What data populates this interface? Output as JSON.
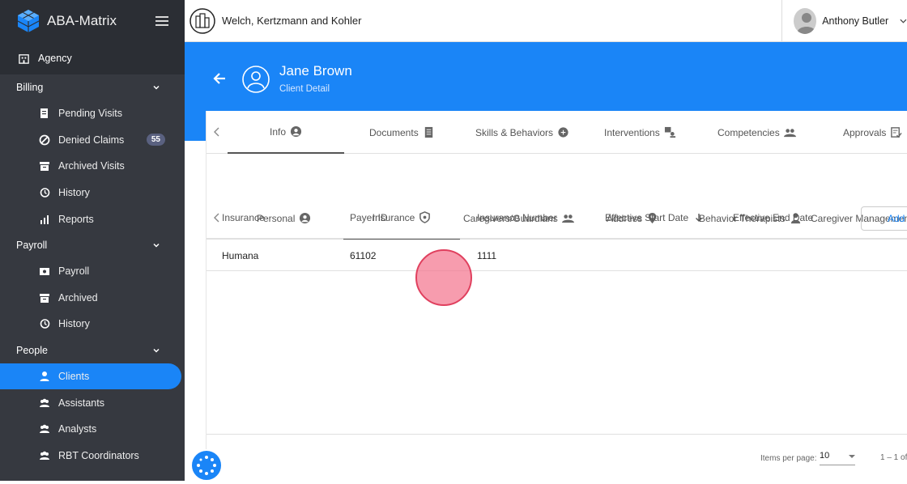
{
  "app": {
    "title": "ABA-Matrix"
  },
  "sidebar": {
    "agency": "Agency",
    "sections": [
      {
        "label": "Billing",
        "items": [
          {
            "label": "Pending Visits"
          },
          {
            "label": "Denied Claims",
            "badge": "55"
          },
          {
            "label": "Archived Visits"
          },
          {
            "label": "History"
          },
          {
            "label": "Reports"
          }
        ]
      },
      {
        "label": "Payroll",
        "items": [
          {
            "label": "Payroll"
          },
          {
            "label": "Archived"
          },
          {
            "label": "History"
          }
        ]
      },
      {
        "label": "People",
        "items": [
          {
            "label": "Clients",
            "active": true
          },
          {
            "label": "Assistants"
          },
          {
            "label": "Analysts"
          },
          {
            "label": "RBT Coordinators"
          }
        ]
      }
    ]
  },
  "topbar": {
    "company": "Welch, Kertzmann and Kohler",
    "user": "Anthony Butler"
  },
  "client": {
    "name": "Jane Brown",
    "subtitle": "Client Detail"
  },
  "tabs": [
    "Info",
    "Documents",
    "Skills & Behaviors",
    "Interventions",
    "Competencies",
    "Approvals"
  ],
  "subtabs": [
    "Personal",
    "Insurance",
    "Caregivers/Guardians",
    "Address",
    "Behavior Therapists",
    "Caregiver Management"
  ],
  "table": {
    "headers": [
      "Insurance",
      "Payer ID",
      "Insurance Number",
      "Effective Start Date",
      "Effective End Date"
    ],
    "add_label": "Add I",
    "rows": [
      [
        "Humana",
        "61102",
        "1111",
        "",
        ""
      ]
    ]
  },
  "pagination": {
    "items_per_page_label": "Items per page:",
    "items_per_page": "10",
    "range": "1 – 1 of"
  },
  "colors": {
    "accent": "#1a85f7",
    "sidebar": "#363940"
  }
}
